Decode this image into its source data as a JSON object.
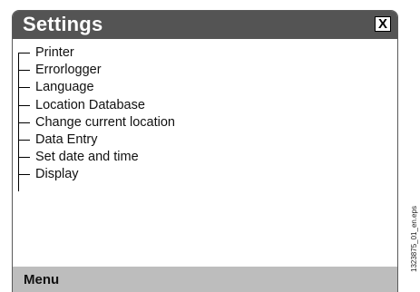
{
  "window": {
    "title": "Settings",
    "close_label": "X"
  },
  "tree": {
    "items": [
      {
        "label": "Printer"
      },
      {
        "label": "Errorlogger"
      },
      {
        "label": "Language"
      },
      {
        "label": "Location Database"
      },
      {
        "label": "Change current location"
      },
      {
        "label": "Data Entry"
      },
      {
        "label": "Set date and time"
      },
      {
        "label": "Display"
      }
    ]
  },
  "menubar": {
    "label": "Menu"
  },
  "caption": "1323875_01_en.eps",
  "colors": {
    "titlebar": "#545454",
    "menubar": "#bdbdbd"
  }
}
